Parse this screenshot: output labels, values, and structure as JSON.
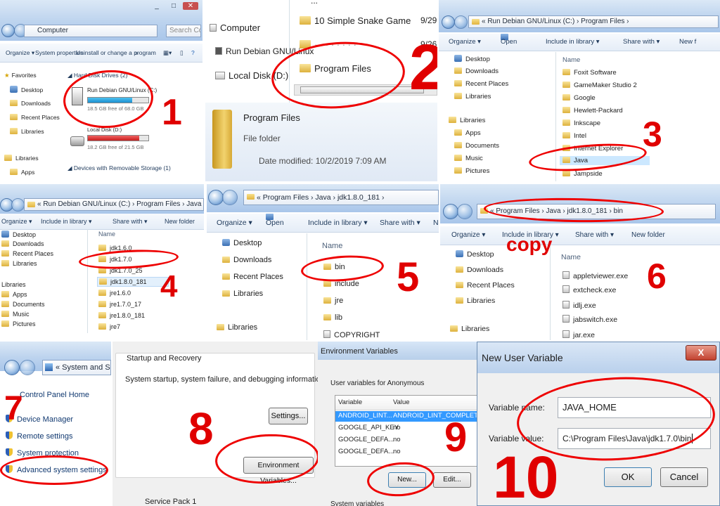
{
  "p1": {
    "title_buttons": [
      "_",
      "□",
      "✕"
    ],
    "address": "Computer",
    "search_placeholder": "Search Co...",
    "toolbar": [
      "Organize ▾",
      "System properties",
      "Uninstall or change a program",
      "»"
    ],
    "nav": [
      "Favorites",
      "Desktop",
      "Downloads",
      "Recent Places",
      "Libraries",
      "Libraries",
      "Apps"
    ],
    "group_label": "◢ Hard Disk Drives (2)",
    "drives": [
      {
        "name": "Run Debian GNU/Linux (C:)",
        "free": "18.5 GB free of 68.0 GB",
        "fill": 0.73
      },
      {
        "name": "Local Disk (D:)",
        "free": "18.2 GB free of 21.5 GB",
        "fill": 0.85
      }
    ],
    "removable_label": "◢ Devices with Removable Storage (1)",
    "step": "1"
  },
  "p2": {
    "nav": [
      "Computer",
      "Run Debian GNU/Linux",
      "Local Disk (D:)"
    ],
    "files": [
      "10 Simple Snake Game",
      "Program Files"
    ],
    "file_top": "...",
    "dates": [
      "9/29",
      "9/26"
    ],
    "details": {
      "name": "Program Files",
      "type": "File folder",
      "modified": "Date modified: 10/2/2019 7:09 AM"
    },
    "step": "2"
  },
  "p3": {
    "address": "«  Run Debian GNU/Linux (C:)  ›  Program Files  ›",
    "toolbar": [
      "Organize ▾",
      "Open",
      "Include in library ▾",
      "Share with ▾",
      "New f"
    ],
    "nav": [
      "Desktop",
      "Downloads",
      "Recent Places",
      "Libraries",
      "Libraries",
      "Apps",
      "Documents",
      "Music",
      "Pictures"
    ],
    "column": "Name",
    "files": [
      "Foxit Software",
      "GameMaker Studio 2",
      "Google",
      "Hewlett-Packard",
      "Inkscape",
      "Intel",
      "Internet Explorer",
      "Java",
      "Jampside"
    ],
    "step": "3"
  },
  "p4": {
    "address": "«  Run Debian GNU/Linux (C:)  ›  Program Files  ›  Java  ›",
    "toolbar": [
      "Organize ▾",
      "Include in library ▾",
      "Share with ▾",
      "New folder"
    ],
    "nav": [
      "Desktop",
      "Downloads",
      "Recent Places",
      "Libraries",
      "Libraries",
      "Apps",
      "Documents",
      "Music",
      "Pictures"
    ],
    "column": "Name",
    "files": [
      "jdk1.6.0",
      "jdk1.7.0",
      "jdk1.7.0_25",
      "jdk1.8.0_181",
      "jre1.6.0",
      "jre1.7.0_17",
      "jre1.8.0_181",
      "jre7"
    ],
    "step": "4"
  },
  "p5": {
    "address": "«  Program Files  ›  Java  ›  jdk1.8.0_181  ›",
    "toolbar": [
      "Organize ▾",
      "Open",
      "Include in library ▾",
      "Share with ▾",
      "N"
    ],
    "nav": [
      "Desktop",
      "Downloads",
      "Recent Places",
      "Libraries",
      "Libraries"
    ],
    "column": "Name",
    "files": [
      "bin",
      "include",
      "jre",
      "lib",
      "COPYRIGHT"
    ],
    "step": "5"
  },
  "p6": {
    "address": "«  Program Files  ›  Java  ›  jdk1.8.0_181  ›  bin",
    "toolbar": [
      "Organize ▾",
      "Include in library ▾",
      "Share with ▾",
      "New folder"
    ],
    "copy_note": "copy",
    "nav": [
      "Desktop",
      "Downloads",
      "Recent Places",
      "Libraries",
      "Libraries"
    ],
    "column": "Name",
    "files": [
      "appletviewer.exe",
      "extcheck.exe",
      "idlj.exe",
      "jabswitch.exe",
      "jar.exe"
    ],
    "step": "6"
  },
  "p7": {
    "address": "«  System and S",
    "home": "Control Panel Home",
    "links": [
      "Device Manager",
      "Remote settings",
      "System protection",
      "Advanced system settings"
    ],
    "step": "7"
  },
  "p8": {
    "section": "Startup and Recovery",
    "description": "System startup, system failure, and debugging information",
    "settings": "Settings...",
    "env_button": "Environment Variables...",
    "step": "8",
    "bottom_text": "Service Pack 1"
  },
  "p9": {
    "title": "Environment Variables",
    "group": "User variables for Anonymous",
    "columns": [
      "Variable",
      "Value"
    ],
    "rows": [
      {
        "var": "ANDROID_LINT...",
        "val": "ANDROID_LINT_COMPLETE_RE"
      },
      {
        "var": "GOOGLE_API_KEY",
        "val": "no"
      },
      {
        "var": "GOOGLE_DEFA...",
        "val": "no"
      },
      {
        "var": "GOOGLE_DEFA...",
        "val": "no"
      }
    ],
    "new_button": "New...",
    "edit_button": "Edit...",
    "step": "9",
    "bottom_text": "System variables"
  },
  "p10": {
    "title": "New User Variable",
    "close": "X",
    "name_label": "Variable name:",
    "name_value": "JAVA_HOME",
    "value_label": "Variable value:",
    "value_value": "C:\\Program Files\\Java\\jdk1.7.0\\bin",
    "ok": "OK",
    "cancel": "Cancel",
    "step": "10"
  },
  "colors": {
    "annotation": "#e00000",
    "selection": "#cce8ff",
    "aero": "#bcd3ee"
  }
}
